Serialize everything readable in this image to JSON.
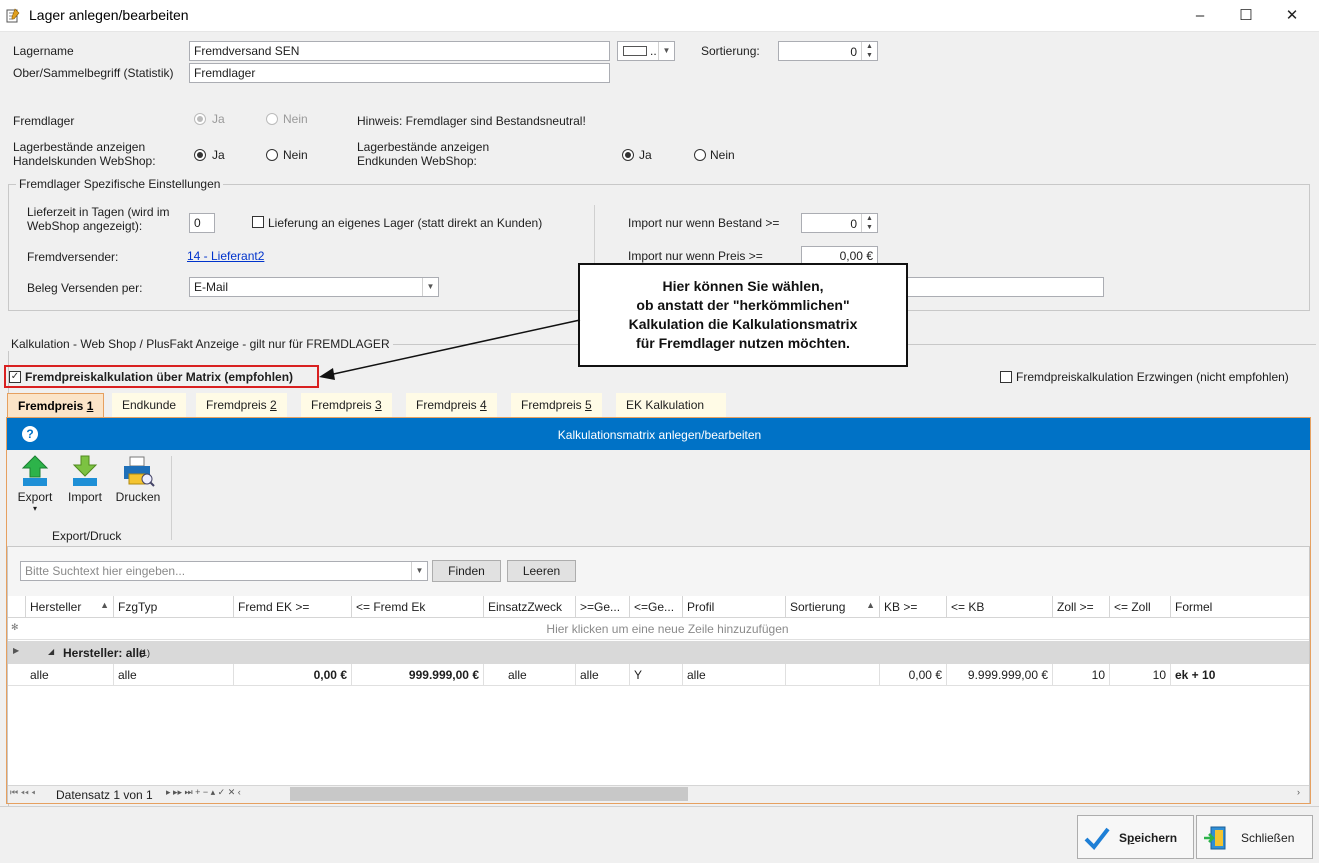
{
  "window": {
    "title": "Lager anlegen/bearbeiten",
    "minimize": "–",
    "maximize": "☐",
    "close": "✕"
  },
  "form": {
    "lagername_label": "Lagername",
    "lagername_value": "Fremdversand SEN",
    "ober_label": "Ober/Sammelbegriff (Statistik)",
    "ober_value": "Fremdlager",
    "color_button": "..",
    "sortierung_label": "Sortierung:",
    "sortierung_value": "0",
    "fremdlager_label": "Fremdlager",
    "ja": "Ja",
    "nein": "Nein",
    "hinweis": "Hinweis: Fremdlager sind Bestandsneutral!",
    "handel_label_1": "Lagerbestände anzeigen",
    "handel_label_2": "Handelskunden WebShop:",
    "endkunden_label_1": "Lagerbestände anzeigen",
    "endkunden_label_2": "Endkunden WebShop:"
  },
  "spezifisch": {
    "title": "Fremdlager Spezifische Einstellungen",
    "lieferzeit_label_1": "Lieferzeit in Tagen (wird im",
    "lieferzeit_label_2": "WebShop angezeigt):",
    "lieferzeit_value": "0",
    "lieferung_label": "Lieferung an eigenes Lager (statt direkt an Kunden)",
    "fremdversender_label": "Fremdversender:",
    "fremdversender_link": "14 - Lieferant2",
    "beleg_label": "Beleg Versenden per:",
    "beleg_value": "E-Mail",
    "import_bestand_label": "Import nur wenn Bestand >=",
    "import_bestand_value": "0",
    "import_preis_label": "Import nur wenn Preis >=",
    "import_preis_value": "0,00 €"
  },
  "callout": {
    "line1": "Hier können Sie wählen,",
    "line2": "ob anstatt der \"herkömmlichen\"",
    "line3": "Kalkulation die Kalkulationsmatrix",
    "line4": "für Fremdlager nutzen möchten."
  },
  "kalkulation": {
    "title": "Kalkulation - Web Shop / PlusFakt Anzeige - gilt nur für FREMDLAGER",
    "matrix_check_label": "Fremdpreiskalkulation über Matrix (empfohlen)",
    "erzwingen_label": "Fremdpreiskalkulation Erzwingen (nicht empfohlen)",
    "tabs": [
      {
        "label": "Fremdpreis ",
        "num": "1"
      },
      {
        "label": "Endkunde",
        "num": ""
      },
      {
        "label": "Fremdpreis ",
        "num": "2"
      },
      {
        "label": "Fremdpreis ",
        "num": "3"
      },
      {
        "label": "Fremdpreis ",
        "num": "4"
      },
      {
        "label": "Fremdpreis ",
        "num": "5"
      },
      {
        "label": "EK Kalkulation",
        "num": ""
      }
    ],
    "matrix_title": "Kalkulationsmatrix anlegen/bearbeiten",
    "help": "?"
  },
  "ribbon": {
    "export": "Export",
    "import": "Import",
    "drucken": "Drucken",
    "group": "Export/Druck"
  },
  "search": {
    "placeholder": "Bitte Suchtext hier eingeben...",
    "finden": "Finden",
    "leeren": "Leeren"
  },
  "grid": {
    "columns": [
      "Hersteller",
      "FzgTyp",
      "Fremd EK >=",
      "<= Fremd Ek",
      "EinsatzZweck",
      ">=Ge...",
      "<=Ge...",
      "Profil",
      "Sortierung",
      "KB >=",
      "<= KB",
      "Zoll >=",
      "<= Zoll",
      "Formel"
    ],
    "new_row": "Hier klicken um eine neue Zeile hinzuzufügen",
    "group_label": "Hersteller: alle",
    "group_count": "(1)",
    "row": [
      "alle",
      "alle",
      "0,00 €",
      "999.999,00 €",
      "alle",
      "alle",
      "Y",
      "alle",
      "",
      "0,00 €",
      "9.999.999,00 €",
      "10",
      "10",
      "ek + 10"
    ],
    "navigator": "Datensatz 1 von 1"
  },
  "footer": {
    "speichern": "Speichern",
    "speichern_u": "p",
    "schliessen": "Schließen"
  }
}
